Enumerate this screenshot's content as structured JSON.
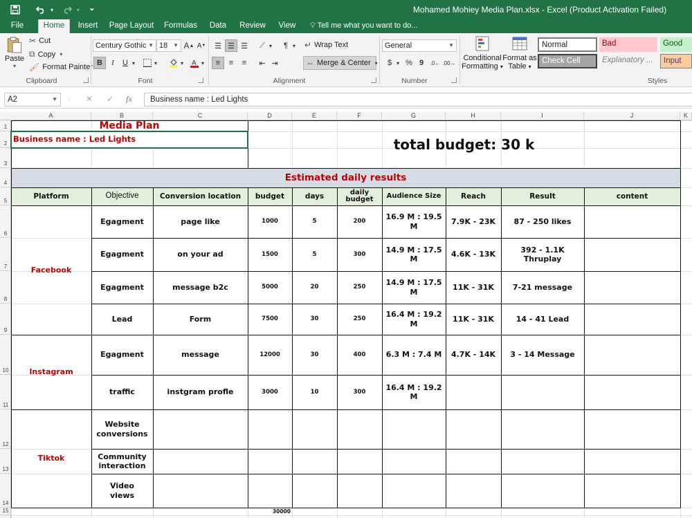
{
  "titlebar": {
    "title": "Mohamed Mohiey Media Plan.xlsx - Excel (Product Activation Failed)",
    "icons": [
      "save-icon",
      "undo-icon",
      "redo-icon",
      "customize-quick-access-icon"
    ]
  },
  "tabs": [
    "File",
    "Home",
    "Insert",
    "Page Layout",
    "Formulas",
    "Data",
    "Review",
    "View"
  ],
  "active_tab": "Home",
  "tell_me": "Tell me what you want to do...",
  "ribbon": {
    "clipboard": {
      "paste": "Paste",
      "cut": "Cut",
      "copy": "Copy",
      "format_painter": "Format Painter",
      "label": "Clipboard"
    },
    "font": {
      "family": "Century Gothic",
      "size": "18",
      "label": "Font",
      "bold": "B",
      "italic": "I",
      "underline": "U",
      "grow": "A",
      "shrink": "A"
    },
    "alignment": {
      "wrap_text": "Wrap Text",
      "merge_center": "Merge & Center",
      "label": "Alignment"
    },
    "number": {
      "format": "General",
      "currency": "$",
      "percent": "%",
      "comma": "9",
      "label": "Number"
    },
    "styles_cmds": {
      "conditional": [
        "Conditional",
        "Formatting"
      ],
      "format_as": [
        "Format as",
        "Table"
      ]
    },
    "styles": {
      "label": "Styles",
      "normal": "Normal",
      "bad": "Bad",
      "good": "Good",
      "check_cell": "Check Cell",
      "explanatory": "Explanatory ...",
      "input": "Input",
      "colors": {
        "bad_bg": "#ffc7ce",
        "bad_fg": "#9c0006",
        "good_bg": "#c6efce",
        "good_fg": "#006100",
        "input_bg": "#ffcc99",
        "input_fg": "#3f3f76",
        "check_bg": "#a5a5a5"
      }
    }
  },
  "formula_bar": {
    "name_box": "A2",
    "cancel": "✕",
    "enter": "✓",
    "fx": "fx",
    "content": "Business name : Led Lights"
  },
  "columns": [
    "A",
    "B",
    "C",
    "D",
    "E",
    "F",
    "G",
    "H",
    "I",
    "J",
    "K"
  ],
  "rows": [
    "1",
    "2",
    "3",
    "4",
    "5",
    "6",
    "7",
    "8",
    "9",
    "10",
    "11",
    "12",
    "13",
    "14",
    "15"
  ],
  "sheet": {
    "media_plan": "Media Plan",
    "business": "Business name : Led Lights",
    "total_budget": "total budget: 30 k",
    "estimated": "Estimated daily results",
    "headers": [
      "Platform",
      "Objective",
      "Conversion location",
      "budget",
      "days",
      "daily budget",
      "Audience Size",
      "Reach",
      "Result",
      "content"
    ],
    "platforms": [
      "Facebook",
      "Instagram",
      "Tiktok"
    ],
    "rows": [
      {
        "objective": "Egagment",
        "location": "page like",
        "budget": "1000",
        "days": "5",
        "daily": "200",
        "audience": "16.9 M : 19.5 M",
        "reach": "7.9K - 23K",
        "result": "87 - 250 likes"
      },
      {
        "objective": "Egagment",
        "location": "on your ad",
        "budget": "1500",
        "days": "5",
        "daily": "300",
        "audience": "14.9 M : 17.5 M",
        "reach": "4.6K - 13K",
        "result": "392 - 1.1K Thruplay"
      },
      {
        "objective": "Egagment",
        "location": "message b2c",
        "budget": "5000",
        "days": "20",
        "daily": "250",
        "audience": "14.9 M : 17.5 M",
        "reach": "11K - 31K",
        "result": "7-21 message"
      },
      {
        "objective": "Lead",
        "location": "Form",
        "budget": "7500",
        "days": "30",
        "daily": "250",
        "audience": "16.4 M : 19.2 M",
        "reach": "11K - 31K",
        "result": "14 - 41 Lead"
      },
      {
        "objective": "Egagment",
        "location": "message",
        "budget": "12000",
        "days": "30",
        "daily": "400",
        "audience": "6.3 M : 7.4 M",
        "reach": "4.7K - 14K",
        "result": "3 - 14 Message"
      },
      {
        "objective": "traffic",
        "location": "instgram profle",
        "budget": "3000",
        "days": "10",
        "daily": "300",
        "audience": "16.4 M : 19.2 M",
        "reach": "",
        "result": ""
      },
      {
        "objective": "Website conversions",
        "location": "",
        "budget": "",
        "days": "",
        "daily": "",
        "audience": "",
        "reach": "",
        "result": ""
      },
      {
        "objective": "Community interaction",
        "location": "",
        "budget": "",
        "days": "",
        "daily": "",
        "audience": "",
        "reach": "",
        "result": ""
      },
      {
        "objective": "Video views",
        "location": "",
        "budget": "",
        "days": "",
        "daily": "",
        "audience": "",
        "reach": "",
        "result": ""
      }
    ],
    "total": "30000",
    "colors": {
      "red": "#c00000",
      "banner": "#d6dce4",
      "header_bg": "#e2efda"
    }
  }
}
